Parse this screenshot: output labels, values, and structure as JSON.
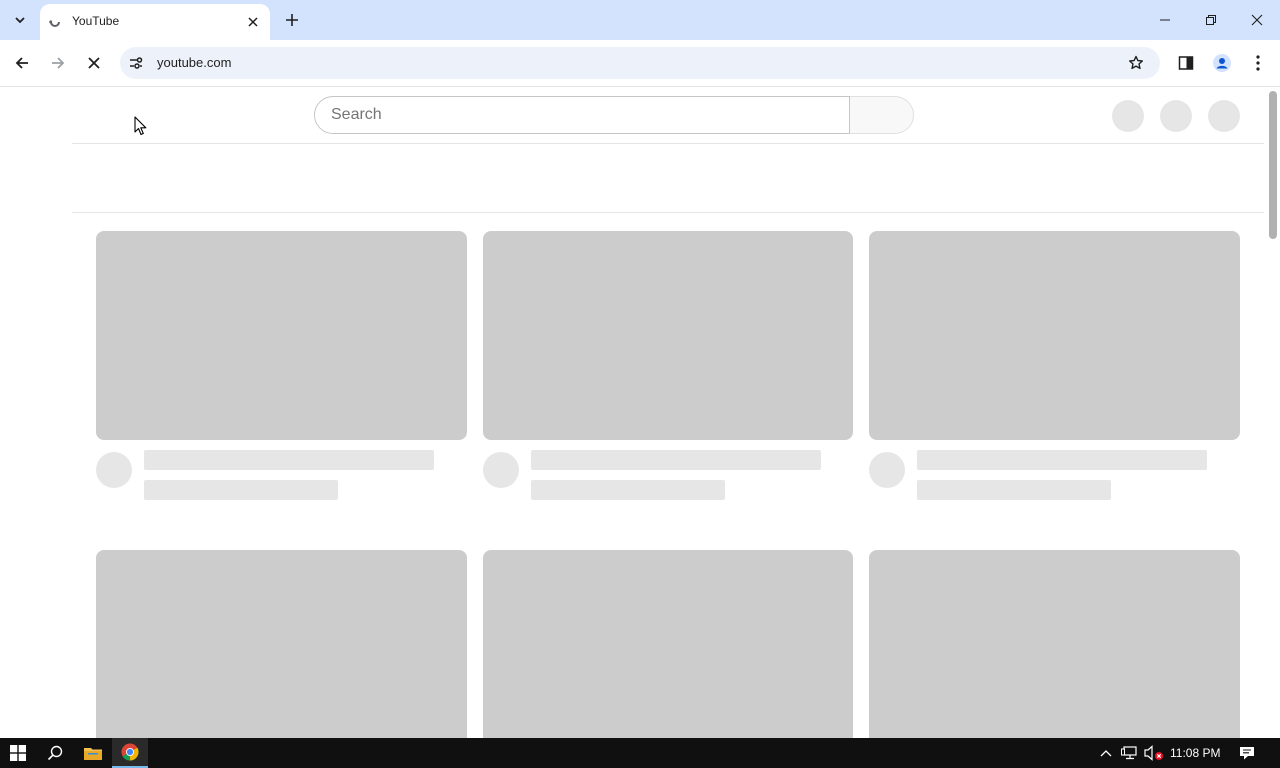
{
  "browser": {
    "tab": {
      "title": "YouTube"
    },
    "address": {
      "url": "youtube.com"
    }
  },
  "page": {
    "search": {
      "placeholder": "Search"
    }
  },
  "taskbar": {
    "clock": "11:08 PM"
  },
  "colors": {
    "tabstrip": "#d3e3fd",
    "skeleton_thumb": "#cccccc",
    "skeleton_text": "#e6e6e6",
    "taskbar": "#101010"
  }
}
